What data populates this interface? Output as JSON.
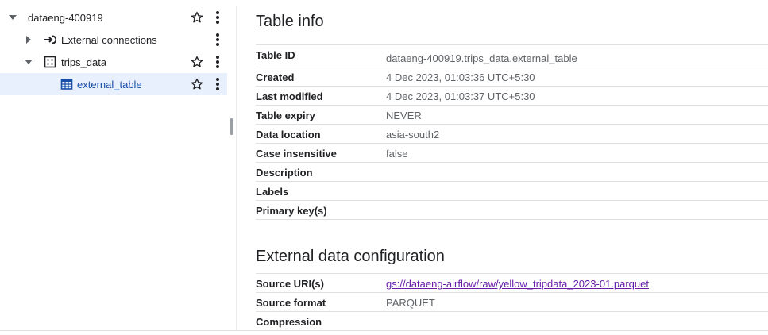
{
  "explorer": {
    "items": [
      {
        "label": "dataeng-400919",
        "icon": "caret-down-icon"
      },
      {
        "label": "External connections",
        "icon": "external-connection-icon"
      },
      {
        "label": "trips_data",
        "icon": "dataset-icon"
      },
      {
        "label": "external_table",
        "icon": "table-icon",
        "selected": true
      }
    ]
  },
  "table_info": {
    "title": "Table info",
    "rows": [
      {
        "key": "Table ID",
        "value": "dataeng-400919.trips_data.external_table"
      },
      {
        "key": "Created",
        "value": "4 Dec 2023, 01:03:36 UTC+5:30"
      },
      {
        "key": "Last modified",
        "value": "4 Dec 2023, 01:03:37 UTC+5:30"
      },
      {
        "key": "Table expiry",
        "value": "NEVER"
      },
      {
        "key": "Data location",
        "value": "asia-south2"
      },
      {
        "key": "Case insensitive",
        "value": "false"
      },
      {
        "key": "Description",
        "value": ""
      },
      {
        "key": "Labels",
        "value": ""
      },
      {
        "key": "Primary key(s)",
        "value": ""
      }
    ]
  },
  "external_config": {
    "title": "External data configuration",
    "rows": [
      {
        "key": "Source URI(s)",
        "value": "gs://dataeng-airflow/raw/yellow_tripdata_2023-01.parquet"
      },
      {
        "key": "Source format",
        "value": "PARQUET"
      },
      {
        "key": "Compression",
        "value": ""
      }
    ]
  },
  "colors": {
    "link": "#681da8",
    "selected_bg": "#e8f0fe",
    "selected_text": "#174ea6"
  }
}
